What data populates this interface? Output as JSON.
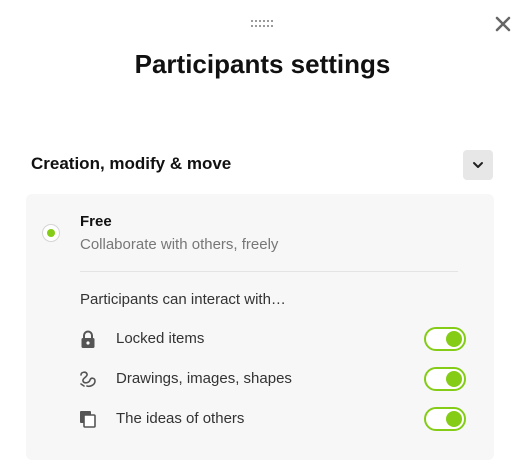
{
  "dialog": {
    "title": "Participants settings"
  },
  "section": {
    "header": "Creation, modify & move"
  },
  "option": {
    "title": "Free",
    "description": "Collaborate with others, freely",
    "selected": true
  },
  "permissions": {
    "intro": "Participants can interact with…",
    "items": [
      {
        "label": "Locked items",
        "icon": "lock-icon",
        "enabled": true
      },
      {
        "label": "Drawings, images, shapes",
        "icon": "drawings-icon",
        "enabled": true
      },
      {
        "label": "The ideas of others",
        "icon": "ideas-icon",
        "enabled": true
      }
    ]
  },
  "colors": {
    "accent": "#84cc16",
    "card_background": "#f7f7f7",
    "collapse_button": "#e7e7e7"
  }
}
